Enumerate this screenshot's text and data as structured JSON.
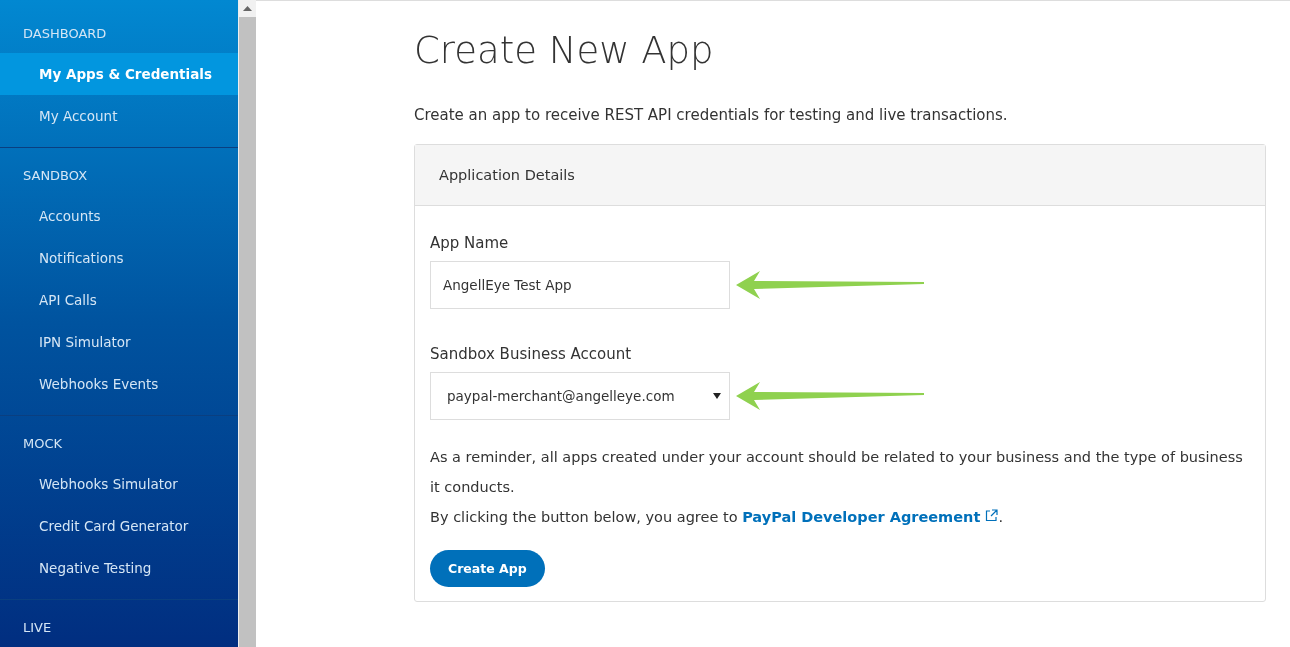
{
  "sidebar": {
    "sections": [
      {
        "heading": "DASHBOARD",
        "items": [
          {
            "label": "My Apps & Credentials",
            "selected": true
          },
          {
            "label": "My Account",
            "selected": false
          }
        ]
      },
      {
        "heading": "SANDBOX",
        "items": [
          {
            "label": "Accounts",
            "selected": false
          },
          {
            "label": "Notifications",
            "selected": false
          },
          {
            "label": "API Calls",
            "selected": false
          },
          {
            "label": "IPN Simulator",
            "selected": false
          },
          {
            "label": "Webhooks Events",
            "selected": false
          }
        ]
      },
      {
        "heading": "MOCK",
        "items": [
          {
            "label": "Webhooks Simulator",
            "selected": false
          },
          {
            "label": "Credit Card Generator",
            "selected": false
          },
          {
            "label": "Negative Testing",
            "selected": false
          }
        ]
      },
      {
        "heading": "LIVE"
      }
    ]
  },
  "page": {
    "title": "Create New App",
    "intro": "Create an app to receive REST API credentials for testing and live transactions.",
    "panel": {
      "header": "Application Details",
      "app_name": {
        "label": "App Name",
        "value": "AngellEye Test App"
      },
      "business_account": {
        "label": "Sandbox Business Account",
        "value": "paypal-merchant@angelleye.com"
      },
      "reminder": "As a reminder, all apps created under your account should be related to your business and the type of business it conducts.",
      "agreement": {
        "before": "By clicking the button below, you agree to ",
        "link": "PayPal Developer Agreement",
        "after": "."
      },
      "button": "Create App"
    }
  }
}
